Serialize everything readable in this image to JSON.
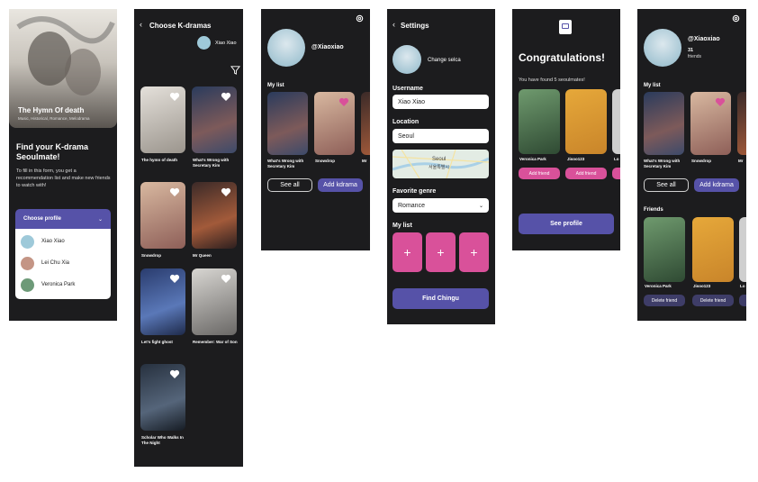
{
  "screen1": {
    "hero_title": "The Hymn Of death",
    "hero_subtitle": "Music, Historical, Romance, Melodrama",
    "heading": "Find your K-drama Seoulmate!",
    "description": "To fill in this form, you get a recommendation list and make new friends to watch with!",
    "dropdown_label": "Choose profile",
    "profiles": [
      "Xiao Xiao",
      "Lei Chu Xia",
      "Veronica Park"
    ]
  },
  "screen2": {
    "title": "Choose K-dramas",
    "user": "Xiao Xiao",
    "dramas": [
      "The hymn of death",
      "What's Wrong with Secretary Kim",
      "Snowdrop",
      "Mr Queen",
      "Let's fight ghost",
      "Remember: War of Son",
      "Scholar Who Walks In The Night"
    ]
  },
  "screen3": {
    "username": "@Xiaoxiao",
    "section": "My list",
    "list": [
      "What's Wrong with Secretary Kim",
      "Snowdrop",
      "Mr"
    ],
    "see_all": "See all",
    "add": "Add kdrama"
  },
  "screen4": {
    "title": "Settings",
    "change_selca": "Change selca",
    "username_label": "Username",
    "username_value": "Xiao Xiao",
    "location_label": "Location",
    "location_value": "Seoul",
    "map_text": "Seoul",
    "map_sub": "서울특별시",
    "genre_label": "Favorite genre",
    "genre_value": "Romance",
    "mylist_label": "My list",
    "plus": "+",
    "find_btn": "Find Chingu"
  },
  "screen5": {
    "title": "Congratulations!",
    "subtitle": "You have found 5 seoulmates!",
    "mates": [
      "Veronica Park",
      "Jisoo123",
      "Lo"
    ],
    "add_friend": "Add friend",
    "see_profile": "See profile"
  },
  "screen6": {
    "username": "@Xiaoxiao",
    "friend_count": "31",
    "friend_label": "friends",
    "section": "My list",
    "list": [
      "What's Wrong with Secretary Kim",
      "Snowdrop",
      "Mr"
    ],
    "see_all": "See all",
    "add": "Add kdrama",
    "friends_title": "Friends",
    "friends": [
      "Veronica Park",
      "Jisoo123",
      "Lo"
    ],
    "delete": "Delete friend"
  },
  "colors": {
    "bg": "#1c1c1e",
    "accent_purple": "#5652a8",
    "accent_pink": "#d9519a"
  }
}
